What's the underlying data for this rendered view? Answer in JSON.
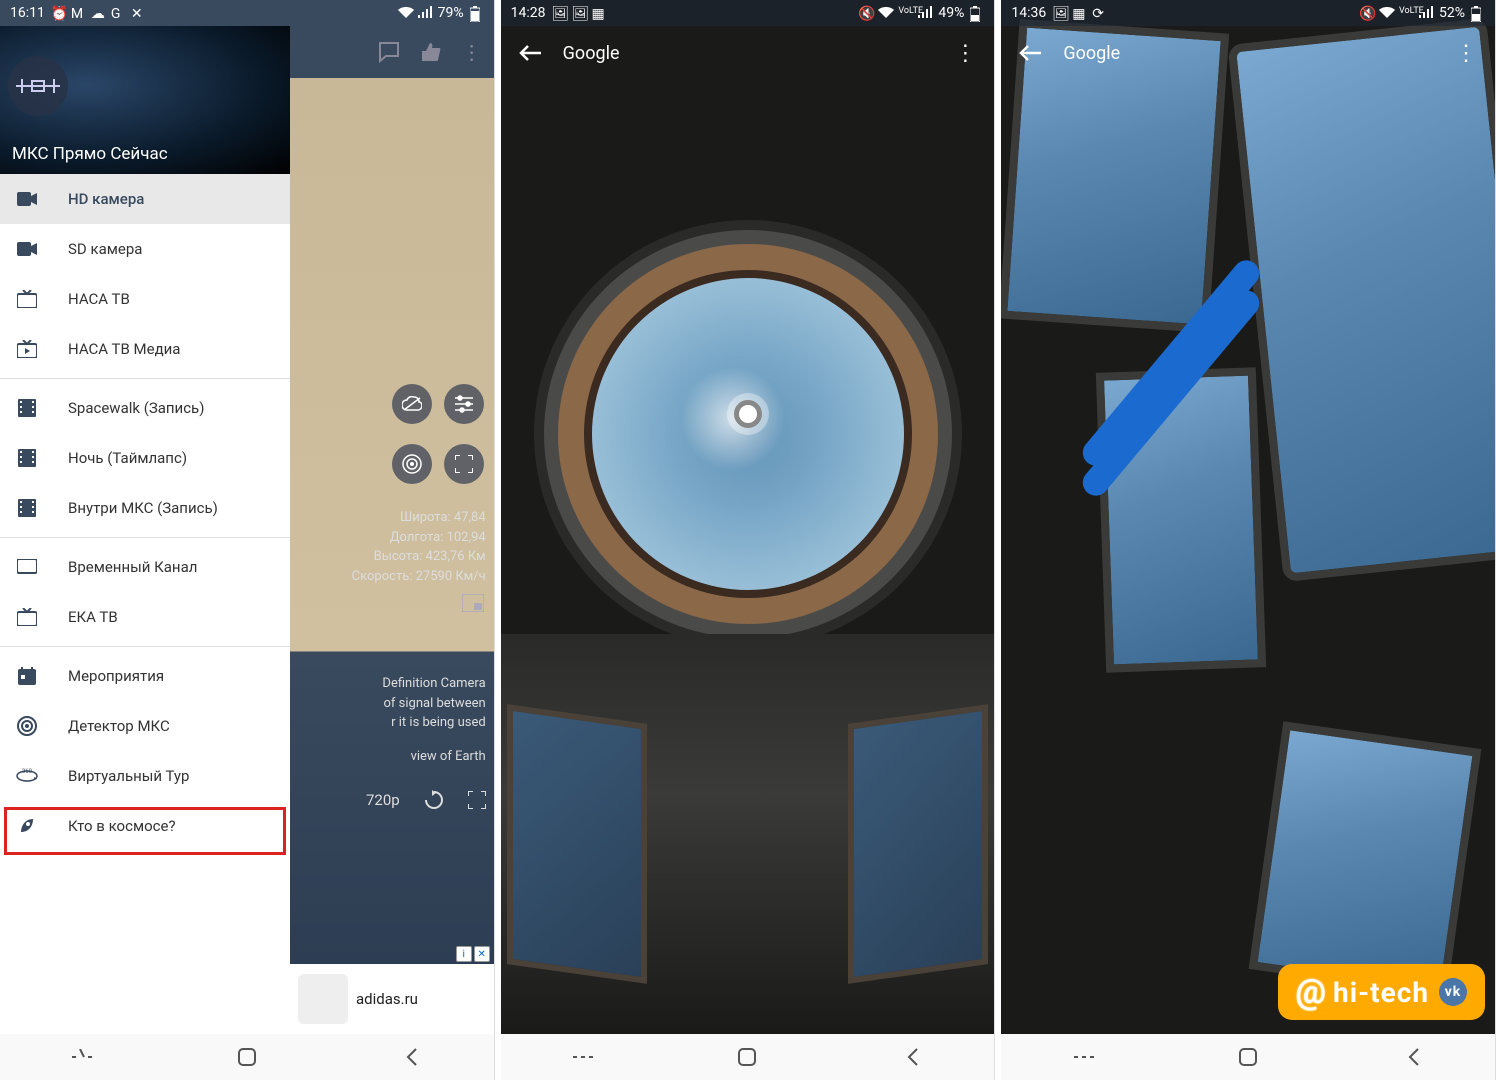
{
  "p1": {
    "status": {
      "time": "16:11",
      "battery": "79%"
    },
    "drawer": {
      "title": "МКС Прямо Сейчас",
      "items": [
        {
          "id": "hd-camera",
          "label": "HD камера",
          "icon": "camera",
          "active": true
        },
        {
          "id": "sd-camera",
          "label": "SD камера",
          "icon": "camera"
        },
        {
          "id": "nasa-tv",
          "label": "НАСА ТВ",
          "icon": "tv"
        },
        {
          "id": "nasa-tv-media",
          "label": "НАСА ТВ Медиа",
          "icon": "tv-play"
        },
        {
          "divider": true
        },
        {
          "id": "spacewalk",
          "label": "Spacewalk (Запись)",
          "icon": "film"
        },
        {
          "id": "night",
          "label": "Ночь (Таймлапс)",
          "icon": "film"
        },
        {
          "id": "inside-iss",
          "label": "Внутри МКС (Запись)",
          "icon": "film"
        },
        {
          "divider": true
        },
        {
          "id": "temp-channel",
          "label": "Временный Канал",
          "icon": "monitor"
        },
        {
          "id": "eka-tv",
          "label": "ЕКА ТВ",
          "icon": "tv"
        },
        {
          "divider": true
        },
        {
          "id": "events",
          "label": "Мероприятия",
          "icon": "calendar"
        },
        {
          "id": "detector",
          "label": "Детектор МКС",
          "icon": "radar"
        },
        {
          "id": "virtual-tour",
          "label": "Виртуальный Тур",
          "icon": "vr",
          "highlight": true
        },
        {
          "id": "whos-in-space",
          "label": "Кто в космосе?",
          "icon": "rocket"
        }
      ]
    },
    "behind": {
      "lat": "Широта: 47,84",
      "lon": "Долгота: 102,94",
      "alt": "Высота: 423,76 Км",
      "speed": "Скорость: 27590 Км/ч",
      "info1": "Definition Camera",
      "info2": "of signal between",
      "info3": "r it is being used",
      "info4": "view of Earth",
      "quality": "720p",
      "ad": "adidas.ru"
    }
  },
  "p2": {
    "status": {
      "time": "14:28",
      "battery": "49%"
    },
    "title": "Google"
  },
  "p3": {
    "status": {
      "time": "14:36",
      "battery": "52%"
    },
    "title": "Google",
    "watermark": "hi-tech"
  }
}
